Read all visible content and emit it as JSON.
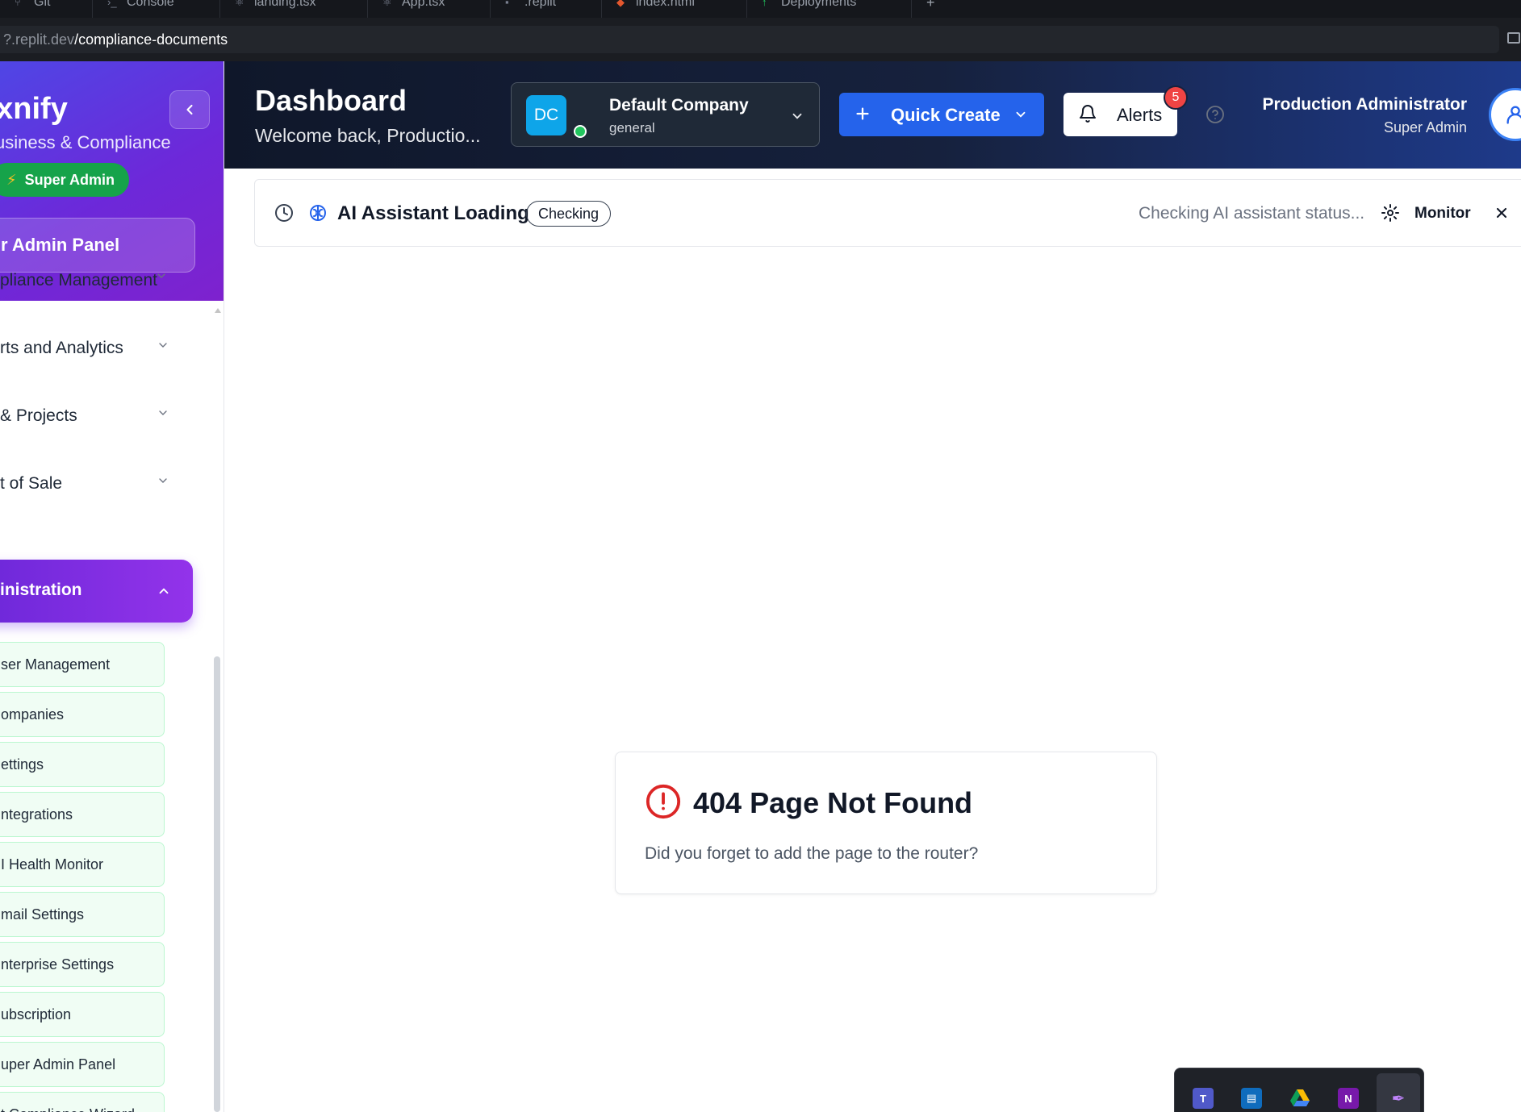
{
  "browser": {
    "tabs": [
      {
        "label": "Git",
        "icon": "git-icon"
      },
      {
        "label": "Console",
        "icon": "terminal-icon"
      },
      {
        "label": "landing.tsx",
        "icon": "react-icon"
      },
      {
        "label": "App.tsx",
        "icon": "react-icon"
      },
      {
        "label": ".replit",
        "icon": "config-icon"
      },
      {
        "label": "index.html",
        "icon": "html-icon"
      },
      {
        "label": "Deployments",
        "icon": "deploy-icon"
      }
    ],
    "new_tab": "+",
    "url_prefix": "?.replit.dev",
    "url_path": "/compliance-documents"
  },
  "sidebar": {
    "brand": "axnify",
    "brand_subtitle": "usiness & Compliance",
    "role_badge": "Super Admin",
    "admin_panel_button": "r Admin Panel",
    "nav_items": [
      {
        "label": "pliance Management"
      },
      {
        "label": "rts and Analytics"
      },
      {
        "label": "& Projects"
      },
      {
        "label": "t of Sale"
      }
    ],
    "active_section": "inistration",
    "sub_items": [
      {
        "label": "ser Management"
      },
      {
        "label": "ompanies"
      },
      {
        "label": "ettings"
      },
      {
        "label": "ntegrations"
      },
      {
        "label": "I Health Monitor"
      },
      {
        "label": "mail Settings"
      },
      {
        "label": "nterprise Settings"
      },
      {
        "label": "ubscription"
      },
      {
        "label": "uper Admin Panel"
      },
      {
        "label": "t Compliance Wizard"
      }
    ]
  },
  "header": {
    "title": "Dashboard",
    "subtitle": "Welcome back, Productio...",
    "company": {
      "initials": "DC",
      "name": "Default Company",
      "type": "general"
    },
    "quick_create": "Quick Create",
    "alerts_label": "Alerts",
    "alerts_count": "5",
    "user_name": "Production Administrator",
    "user_role": "Super Admin"
  },
  "ai_bar": {
    "title": "AI Assistant Loading",
    "status_pill": "Checking",
    "status_text": "Checking AI assistant status...",
    "monitor_label": "Monitor"
  },
  "not_found": {
    "title": "404 Page Not Found",
    "message": "Did you forget to add the page to the router?"
  },
  "tray": {
    "icons": [
      "teams-icon",
      "outlook-icon",
      "google-drive-icon",
      "onenote-icon",
      "pen-icon"
    ]
  },
  "colors": {
    "sidebar_gradient_start": "#4f46e5",
    "sidebar_gradient_end": "#7e22ce",
    "header_bg": "#0f172a",
    "primary": "#2563eb",
    "success": "#16a34a",
    "danger": "#ef4444"
  }
}
